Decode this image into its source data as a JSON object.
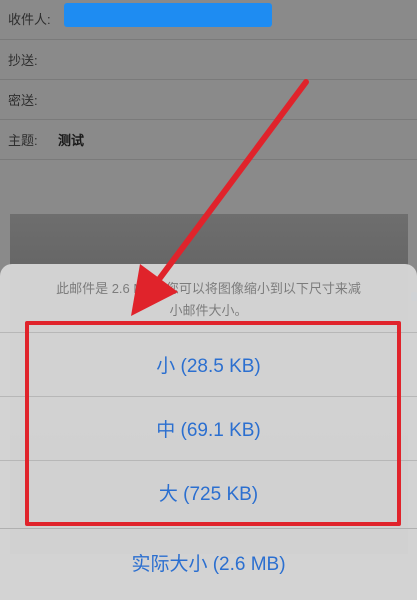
{
  "compose": {
    "to_label": "收件人:",
    "cc_label": "抄送:",
    "bcc_label": "密送:",
    "subject_label": "主题:",
    "subject_value": "测试"
  },
  "action_sheet": {
    "message_line1": "此邮件是 2.6 MB。您可以将图像缩小到以下尺寸来减",
    "message_line2": "小邮件大小。",
    "options": [
      {
        "label": "小 (28.5 KB)"
      },
      {
        "label": "中 (69.1 KB)"
      },
      {
        "label": "大 (725 KB)"
      },
      {
        "label": "实际大小 (2.6 MB)"
      }
    ]
  },
  "colors": {
    "option_text": "#2b6fd0",
    "annotation_red": "#e0232b",
    "recipient_chip": "#1e8cf2"
  },
  "annotation": {
    "arrow": "red arrow pointing at the size options",
    "box": "red highlight box around small/medium/large options"
  }
}
